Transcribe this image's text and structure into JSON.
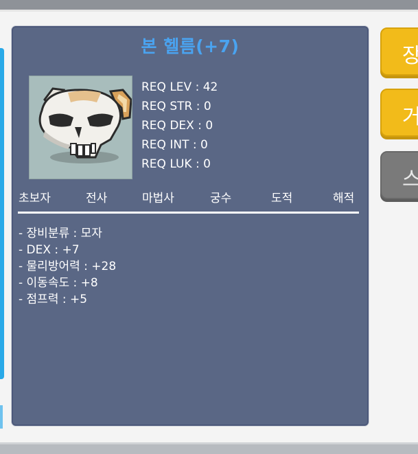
{
  "item": {
    "name": "본 헬름(+7)",
    "icon": "bone-helm-skull-icon"
  },
  "requirements": [
    {
      "label": "REQ LEV : 42"
    },
    {
      "label": "REQ STR : 0"
    },
    {
      "label": "REQ DEX : 0"
    },
    {
      "label": "REQ INT : 0"
    },
    {
      "label": "REQ LUK : 0"
    }
  ],
  "jobs": [
    "초보자",
    "전사",
    "마법사",
    "궁수",
    "도적",
    "해적"
  ],
  "stats": [
    "- 장비분류 : 모자",
    "- DEX : +7",
    "- 물리방어력 : +28",
    "- 이동속도 : +8",
    "- 점프력 : +5"
  ],
  "side_buttons": [
    {
      "label": "장",
      "style": "yellow"
    },
    {
      "label": "거",
      "style": "yellow"
    },
    {
      "label": "스",
      "style": "gray"
    }
  ],
  "colors": {
    "panel": "#5a6785",
    "title": "#4aa3f0",
    "button_yellow": "#f2bb1a",
    "button_gray": "#7a7a7a"
  }
}
